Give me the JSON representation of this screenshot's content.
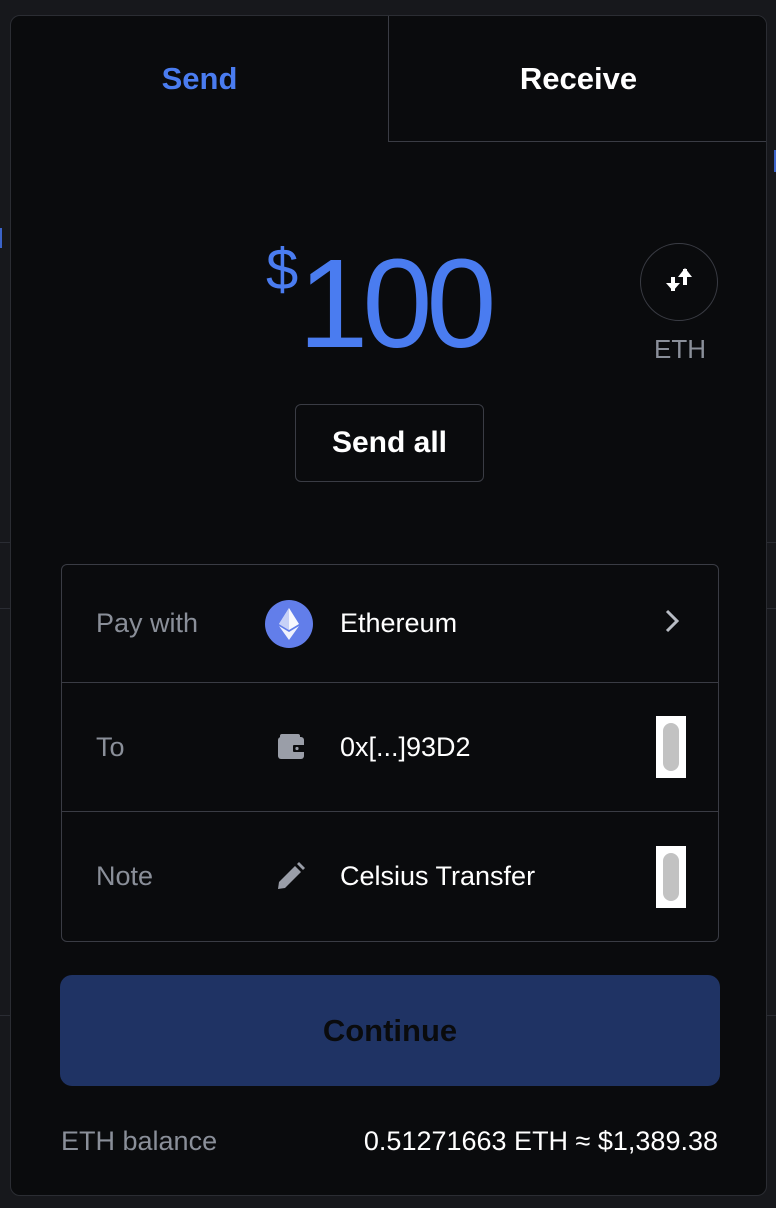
{
  "tabs": {
    "send": "Send",
    "receive": "Receive"
  },
  "amount": {
    "currency_symbol": "$",
    "value": "100"
  },
  "swap": {
    "label": "ETH",
    "icon": "swap-arrows-icon"
  },
  "send_all_label": "Send all",
  "form": {
    "pay_with": {
      "label": "Pay with",
      "value": "Ethereum",
      "icon": "ethereum-icon"
    },
    "to": {
      "label": "To",
      "value": "0x[...]93D2",
      "icon": "wallet-icon"
    },
    "note": {
      "label": "Note",
      "value": "Celsius Transfer",
      "icon": "pencil-icon"
    }
  },
  "continue_label": "Continue",
  "balance": {
    "label": "ETH balance",
    "value": "0.51271663 ETH ≈ $1,389.38"
  },
  "colors": {
    "accent": "#4a7cf0",
    "background": "#0a0b0d",
    "button": "#1f3364",
    "muted": "#8a8f99"
  }
}
